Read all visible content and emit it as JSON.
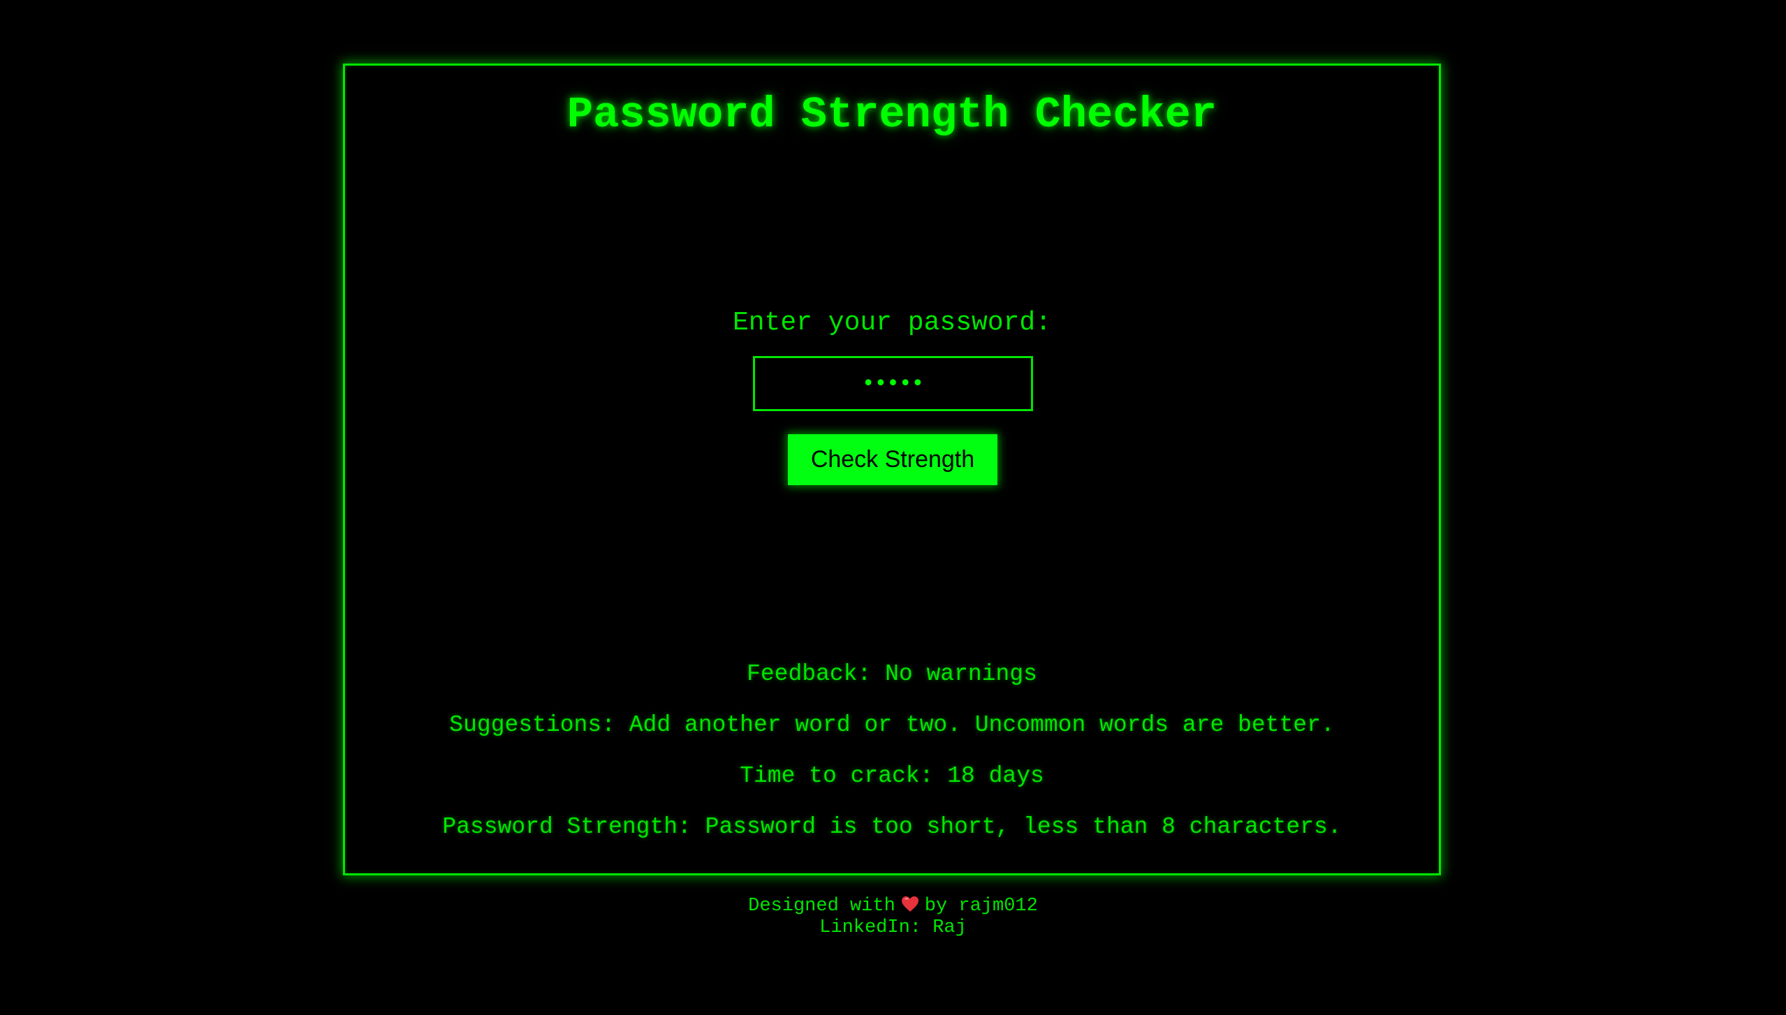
{
  "title": "Password Strength Checker",
  "form": {
    "label": "Enter your password:",
    "password_value": "•••••",
    "button_label": "Check Strength"
  },
  "results": {
    "feedback": "Feedback: No warnings",
    "suggestions": "Suggestions: Add another word or two. Uncommon words are better.",
    "time_to_crack": "Time to crack: 18 days",
    "strength": "Password Strength: Password is too short, less than 8 characters."
  },
  "footer": {
    "designed_prefix": "Designed with",
    "heart_icon": "heart-icon",
    "designed_suffix": "by rajm012",
    "linkedin_label": "LinkedIn:",
    "linkedin_name": "Raj"
  },
  "colors": {
    "background": "#000000",
    "accent": "#00ff00",
    "button_bg": "#00ff11",
    "button_text": "#000000",
    "heart": "#e8323c"
  }
}
